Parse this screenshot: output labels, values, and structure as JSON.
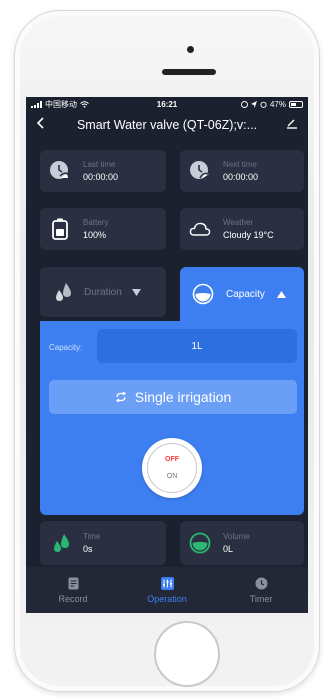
{
  "status_bar": {
    "carrier": "中国移动",
    "time": "16:21",
    "battery": "47%"
  },
  "nav": {
    "title": "Smart Water valve (QT-06Z);v:..."
  },
  "info_cards": {
    "last_time": {
      "label": "Last time",
      "value": "00:00:00",
      "icon": "clock-back-icon"
    },
    "next_time": {
      "label": "Next time",
      "value": "00:00:00",
      "icon": "clock-forward-icon"
    },
    "battery": {
      "label": "Battery",
      "value": "100%",
      "icon": "battery-icon"
    },
    "weather": {
      "label": "Weather",
      "value": "Cloudy 19°C",
      "icon": "cloud-icon"
    }
  },
  "mode_tabs": {
    "duration": "Duration",
    "capacity": "Capacity",
    "active": "capacity"
  },
  "capacity_panel": {
    "label": "Capacity:",
    "value": "1L",
    "irrigation_button": "Single irrigation",
    "switch_off": "OFF",
    "switch_on": "ON"
  },
  "bottom_stats": {
    "time": {
      "label": "Time",
      "value": "0s"
    },
    "volume": {
      "label": "Volume",
      "value": "0L"
    }
  },
  "tabbar": {
    "record": "Record",
    "operation": "Operation",
    "timer": "Timer",
    "active": "operation"
  },
  "colors": {
    "accent": "#3d7ff0",
    "background": "#1c2130",
    "card": "#2a3042",
    "green": "#2bb673",
    "off_red": "#ff3b3b"
  }
}
